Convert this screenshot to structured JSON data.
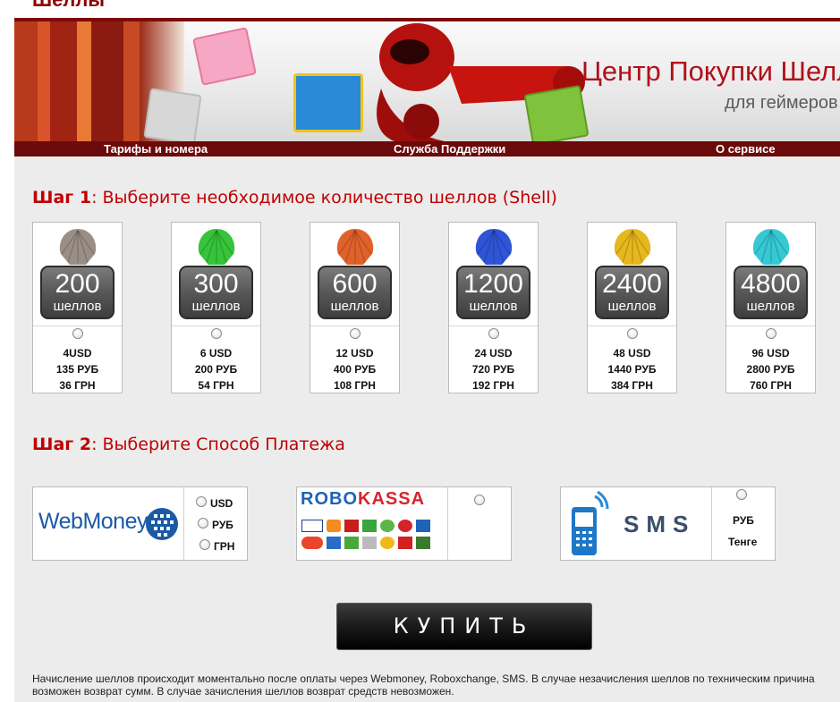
{
  "page": {
    "heading": "Шеллы"
  },
  "banner": {
    "title": "Центр Покупки Шеллов",
    "subtitle": "для геймеров"
  },
  "nav": {
    "items": [
      "Тарифы и номера",
      "Служба Поддержки",
      "О сервисе"
    ]
  },
  "step1": {
    "label": "Шаг 1",
    "text": ": Выберите необходимое количество шеллов (Shell)"
  },
  "packages": [
    {
      "amount": "200",
      "unit": "шеллов",
      "usd": "4USD",
      "rub": "135 РУБ",
      "grn": "36 ГРН",
      "color": "#9a8f86"
    },
    {
      "amount": "300",
      "unit": "шеллов",
      "usd": "6 USD",
      "rub": "200 РУБ",
      "grn": "54 ГРН",
      "color": "#35c43a"
    },
    {
      "amount": "600",
      "unit": "шеллов",
      "usd": "12 USD",
      "rub": "400 РУБ",
      "grn": "108 ГРН",
      "color": "#e0622a"
    },
    {
      "amount": "1200",
      "unit": "шеллов",
      "usd": "24 USD",
      "rub": "720 РУБ",
      "grn": "192 ГРН",
      "color": "#2f55d6"
    },
    {
      "amount": "2400",
      "unit": "шеллов",
      "usd": "48 USD",
      "rub": "1440 РУБ",
      "grn": "384 ГРН",
      "color": "#e6b81e"
    },
    {
      "amount": "4800",
      "unit": "шеллов",
      "usd": "96 USD",
      "rub": "2800 РУБ",
      "grn": "760 ГРН",
      "color": "#35c9d4"
    }
  ],
  "step2": {
    "label": "Шаг 2",
    "text": ": Выберите Способ Платежа"
  },
  "payments": {
    "webmoney": {
      "logo": "WebMoney",
      "options": [
        "USD",
        "РУБ",
        "ГРН"
      ]
    },
    "robokassa": {
      "logo_a": "ROBO",
      "logo_b": "KASSA"
    },
    "sms": {
      "logo": "SMS",
      "options": [
        "РУБ",
        "Тенге"
      ]
    }
  },
  "buy_label": "КУПИТЬ",
  "footnote": {
    "line1": "Начисление шеллов происходит моментально после оплаты через Webmoney, Roboxchange, SMS. В случае незачисления шеллов по техническим причина",
    "line2": "возможен возврат сумм. В случае зачисления шеллов возврат средств невозможен."
  }
}
